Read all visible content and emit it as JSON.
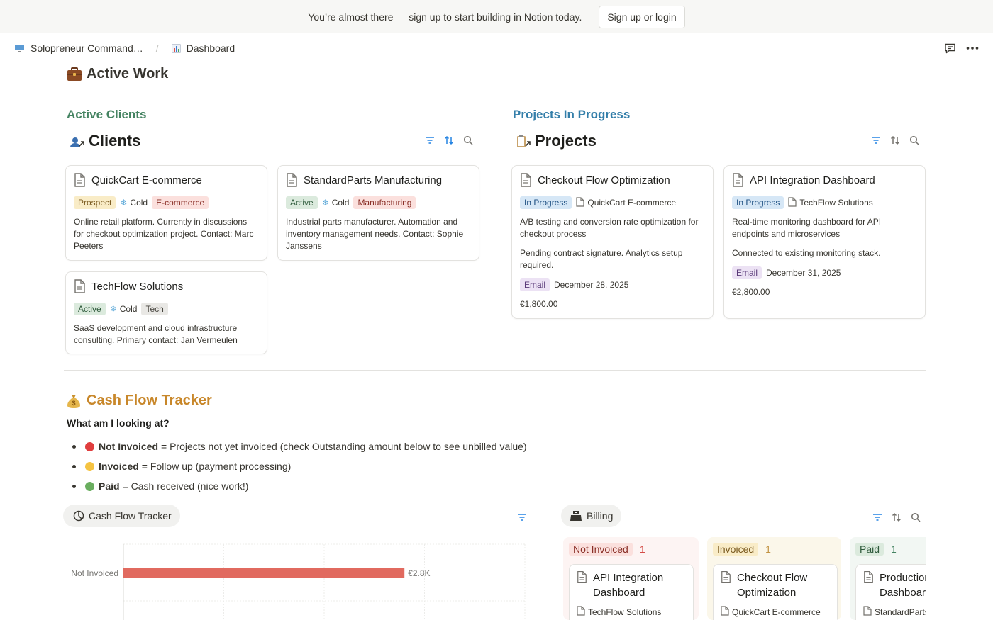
{
  "banner": {
    "text": "You’re almost there — sign up to start building in Notion today.",
    "button": "Sign up or login"
  },
  "breadcrumb": {
    "workspace": "Solopreneur Command…",
    "page": "Dashboard"
  },
  "page": {
    "section_title": "Active Work"
  },
  "clients": {
    "heading": "Active Clients",
    "db_title": "Clients",
    "cards": [
      {
        "name": "QuickCart E-commerce",
        "status": "Prospect",
        "temp": "Cold",
        "industry": "E-commerce",
        "desc": "Online retail platform. Currently in discussions for checkout optimization project. Contact: Marc Peeters"
      },
      {
        "name": "StandardParts Manufacturing",
        "status": "Active",
        "temp": "Cold",
        "industry": "Manufacturing",
        "desc": "Industrial parts manufacturer. Automation and inventory management needs. Contact: Sophie Janssens"
      },
      {
        "name": "TechFlow Solutions",
        "status": "Active",
        "temp": "Cold",
        "industry": "Tech",
        "desc": "SaaS development and cloud infrastructure consulting. Primary contact: Jan Vermeulen"
      }
    ]
  },
  "projects": {
    "heading": "Projects In Progress",
    "db_title": "Projects",
    "cards": [
      {
        "name": "Checkout Flow Optimization",
        "status": "In Progress",
        "client": "QuickCart E-commerce",
        "desc": "A/B testing and conversion rate optimization for checkout process",
        "note": "Pending contract signature. Analytics setup required.",
        "channel": "Email",
        "date": "December 28, 2025",
        "amount": "€1,800.00"
      },
      {
        "name": "API Integration Dashboard",
        "status": "In Progress",
        "client": "TechFlow Solutions",
        "desc": "Real-time monitoring dashboard for API endpoints and microservices",
        "note": "Connected to existing monitoring stack.",
        "channel": "Email",
        "date": "December 31, 2025",
        "amount": "€2,800.00"
      }
    ]
  },
  "cashflow": {
    "title": "Cash Flow Tracker",
    "question": "What am I looking at?",
    "legend": [
      {
        "label": "Not Invoiced",
        "text": "= Projects not yet invoiced (check Outstanding amount below to see unbilled value)",
        "color": "#e03e3e"
      },
      {
        "label": "Invoiced",
        "text": "= Follow up (payment processing)",
        "color": "#f5c342"
      },
      {
        "label": "Paid",
        "text": "= Cash received (nice work!)",
        "color": "#6aae5f"
      }
    ],
    "chart_tab": "Cash Flow Tracker",
    "billing_tab": "Billing"
  },
  "chart_data": {
    "type": "bar",
    "categories": [
      "Not Invoiced"
    ],
    "values": [
      2800
    ],
    "data_labels": [
      "€2.8K"
    ],
    "xlim": [
      0,
      4000
    ],
    "bar_color": "#e16a5f",
    "grid": true
  },
  "billing": {
    "columns": [
      {
        "label": "Not Invoiced",
        "count": "1",
        "card_title": "API Integration Dashboard",
        "card_sub": "TechFlow Solutions"
      },
      {
        "label": "Invoiced",
        "count": "1",
        "card_title": "Checkout Flow Optimization",
        "card_sub": "QuickCart E-commerce"
      },
      {
        "label": "Paid",
        "count": "1",
        "card_title": "Production Dashboard",
        "card_sub": "StandardParts"
      }
    ]
  },
  "colors": {
    "clients_heading": "#448361",
    "projects_heading": "#337ea9",
    "cashflow_heading": "#c8872a",
    "tool_icon": "#2383e2"
  }
}
